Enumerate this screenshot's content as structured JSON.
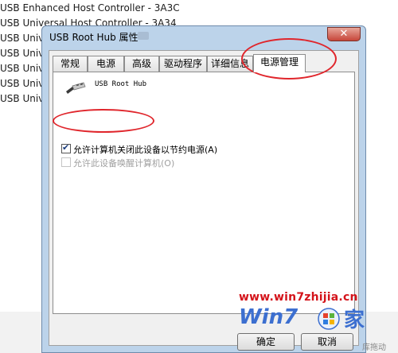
{
  "background": {
    "items": [
      "USB Enhanced Host Controller - 3A3C",
      "USB Universal Host Controller - 3A34",
      "USB Univer",
      "USB Univer",
      "USB Univer",
      "USB Univer",
      "USB Univer"
    ]
  },
  "dialog": {
    "title": "USB Root Hub 属性",
    "close_glyph": "✕",
    "tabs": [
      {
        "label": "常规"
      },
      {
        "label": "电源"
      },
      {
        "label": "高级"
      },
      {
        "label": "驱动程序"
      },
      {
        "label": "详细信息"
      },
      {
        "label": "电源管理",
        "active": true
      }
    ],
    "device_name": "USB Root Hub",
    "options": [
      {
        "label": "允许计算机关闭此设备以节约电源(A)",
        "checked": true,
        "enabled": true
      },
      {
        "label": "允许此设备唤醒计算机(O)",
        "checked": false,
        "enabled": false
      }
    ],
    "buttons": {
      "ok": "确定",
      "cancel": "取消"
    }
  },
  "watermark": {
    "url": "www.win7zhijia.cn",
    "logo": "Win7",
    "logo_suffix": "家",
    "tail": "库拖动"
  },
  "colors": {
    "annotation": "#e0262c",
    "watermark_red": "#d4141b",
    "watermark_blue": "#3c6fd0"
  },
  "icons": [
    "usb-plug-icon",
    "close-icon",
    "checkbox-checked-icon",
    "checkbox-unchecked-icon",
    "windows-globe-icon"
  ]
}
